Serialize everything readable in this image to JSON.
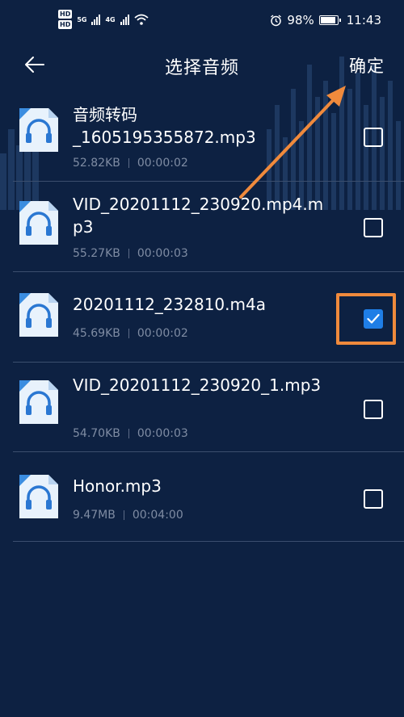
{
  "status_bar": {
    "hd1": "HD",
    "hd2": "HD",
    "net1": "5G",
    "net2": "4G",
    "battery_text": "98%",
    "battery_level": 0.98,
    "time": "11:43"
  },
  "header": {
    "title": "选择音频",
    "confirm_label": "确定",
    "back_icon": "arrow-left-icon"
  },
  "files": [
    {
      "name": "音频转码\n_1605195355872.mp3",
      "size": "52.82KB",
      "duration": "00:00:02",
      "checked": false
    },
    {
      "name": "VID_20201112_230920.mp4.mp3",
      "size": "55.27KB",
      "duration": "00:00:03",
      "checked": false
    },
    {
      "name": "20201112_232810.m4a",
      "size": "45.69KB",
      "duration": "00:00:02",
      "checked": true
    },
    {
      "name": "VID_20201112_230920_1.mp3",
      "size": "54.70KB",
      "duration": "00:00:03",
      "checked": false
    },
    {
      "name": "Honor.mp3",
      "size": "9.47MB",
      "duration": "00:04:00",
      "checked": false
    }
  ],
  "colors": {
    "background": "#0d2142",
    "accent": "#1f7ee6",
    "annotation": "#f08a3c"
  }
}
